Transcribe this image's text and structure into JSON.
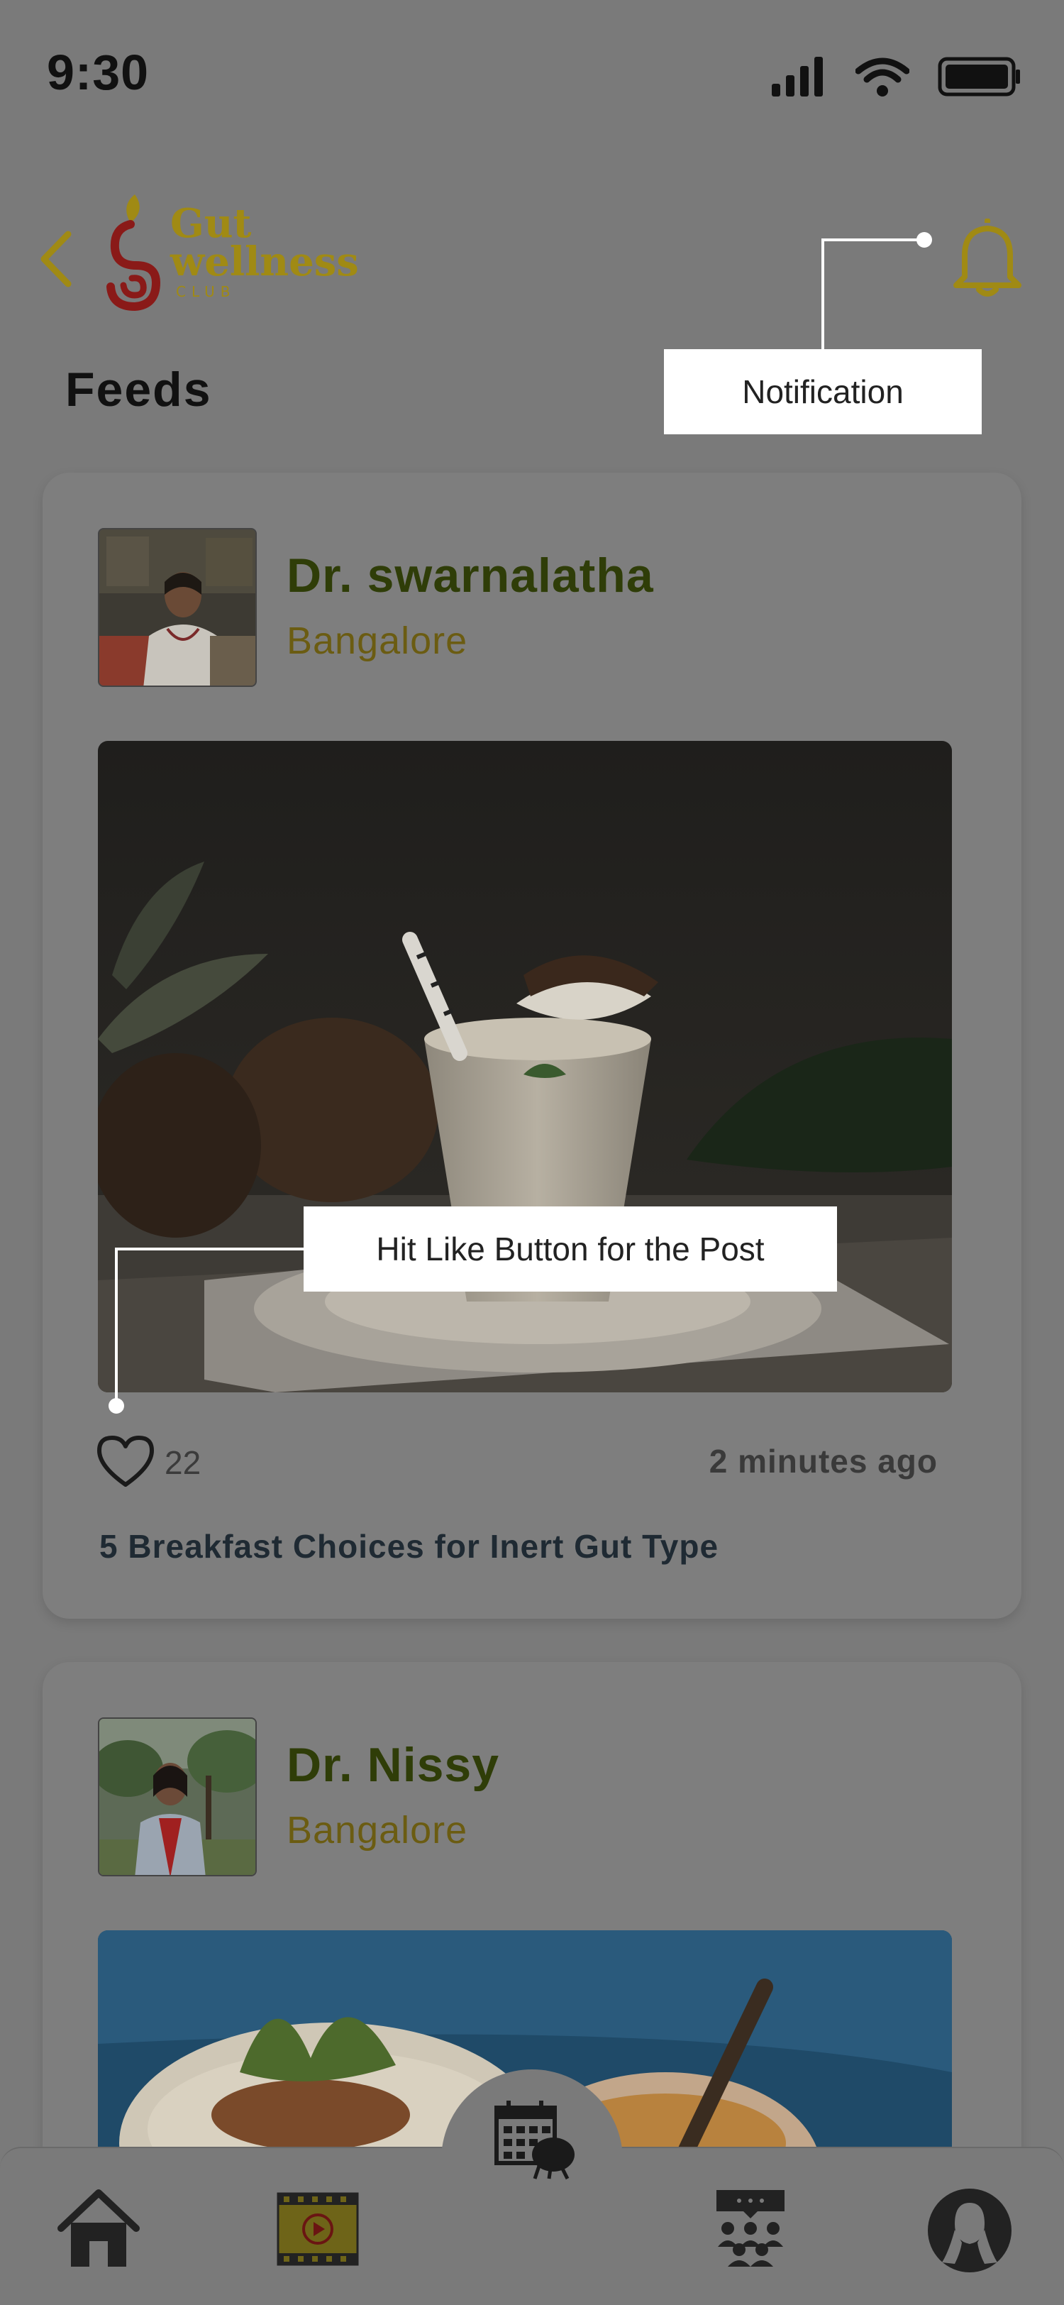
{
  "status_bar": {
    "time": "9:30",
    "icons": [
      "cellular-signal-icon",
      "wifi-icon",
      "battery-icon"
    ]
  },
  "header": {
    "back_icon": "chevron-left-icon",
    "logo": {
      "line1": "Gut",
      "line2": "wellness",
      "line3": "CLUB"
    },
    "notification_icon": "bell-icon",
    "title": "Feeds"
  },
  "tooltips": {
    "notification": "Notification",
    "like": "Hit Like Button for the Post"
  },
  "posts": [
    {
      "doctor_name": "Dr. swarnalatha",
      "city": "Bangalore",
      "likes": "22",
      "time_ago": "2 minutes ago",
      "title": "5 Breakfast Choices for Inert Gut Type"
    },
    {
      "doctor_name": "Dr. Nissy",
      "city": "Bangalore"
    }
  ],
  "bottom_nav": {
    "items": [
      "home-icon",
      "video-icon",
      "calendar-icon",
      "community-icon",
      "profile-icon"
    ]
  },
  "colors": {
    "overlay_bg": "#7a7a7a",
    "doctor_name": "#2f3d08",
    "city": "#6b5c12",
    "brand_gold": "#a08a14",
    "brand_red": "#8a1a18"
  }
}
